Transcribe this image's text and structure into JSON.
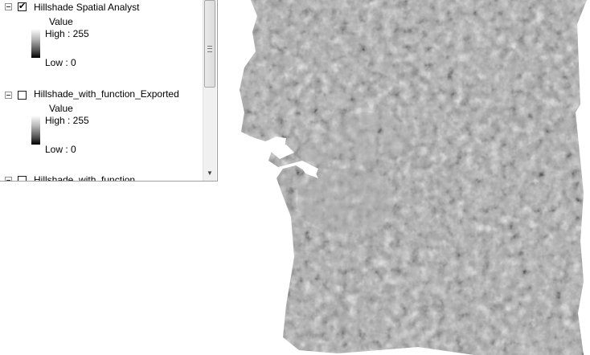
{
  "toc": {
    "layers": [
      {
        "name": "Hillshade Spatial Analyst",
        "checked": true,
        "check_glyph": "✔",
        "legend": {
          "title": "Value",
          "high": "High : 255",
          "low": "Low : 0"
        }
      },
      {
        "name": "Hillshade_with_function_Exported",
        "checked": false,
        "check_glyph": "",
        "legend": {
          "title": "Value",
          "high": "High : 255",
          "low": "Low : 0"
        }
      },
      {
        "name": "Hillshade_with_function",
        "checked": false,
        "check_glyph": ""
      }
    ],
    "scroll": {
      "thumb_fraction": 0.52,
      "down_arrow": "▼"
    }
  },
  "map": {
    "fill_color": "#a9a9a9",
    "shadow_color": "#1e1e1e",
    "highlight_color": "#f4f4f4"
  }
}
